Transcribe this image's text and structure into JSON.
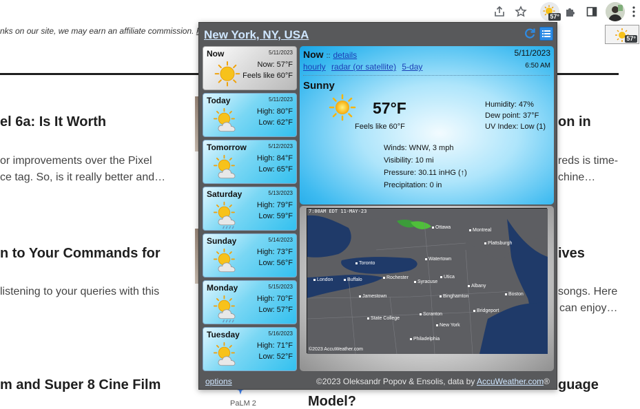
{
  "page": {
    "affiliate_text": "nks on our site, we may earn an affiliate commission.",
    "affiliate_link": "R",
    "articles": [
      {
        "title": "el 6a: Is It Worth",
        "line1": "or improvements over the Pixel",
        "line2": "ce tag. So, is it really better and…"
      },
      {
        "title": "n to Your Commands for",
        "line1": "listening to your queries with this",
        "line2": ""
      },
      {
        "title": "m and Super 8 Cine Film",
        "line1": "",
        "line2": ""
      }
    ],
    "right_fragments": {
      "title1": "on in",
      "body1a": "reds is time-",
      "body1b": "chine…",
      "title2": "ives",
      "body2a": "songs. Here",
      "body2b": "can enjoy…",
      "title3a": "guage",
      "title3b": "Model?"
    },
    "palm_label": "PaLM 2"
  },
  "toolbar": {
    "share_icon": "share-icon",
    "star_icon": "star-icon",
    "ext_badge": "57°",
    "puzzle_icon": "extensions-icon",
    "sidepanel_icon": "side-panel-icon",
    "menu_icon": "kebab-menu-icon",
    "float_badge": "57°"
  },
  "weather": {
    "location": "New York, NY, USA",
    "days": [
      {
        "name": "Now",
        "date": "5/11/2023",
        "line1": "Now: 57°F",
        "line2": "Feels like 60°F",
        "icon": "sun-icon",
        "selected": true
      },
      {
        "name": "Today",
        "date": "5/11/2023",
        "line1": "High: 80°F",
        "line2": "Low: 62°F",
        "icon": "partly-cloudy-icon"
      },
      {
        "name": "Tomorrow",
        "date": "5/12/2023",
        "line1": "High: 84°F",
        "line2": "Low: 65°F",
        "icon": "partly-cloudy-icon"
      },
      {
        "name": "Saturday",
        "date": "5/13/2023",
        "line1": "High: 79°F",
        "line2": "Low: 59°F",
        "icon": "sun-rain-icon"
      },
      {
        "name": "Sunday",
        "date": "5/14/2023",
        "line1": "High: 73°F",
        "line2": "Low: 56°F",
        "icon": "partly-cloudy-icon"
      },
      {
        "name": "Monday",
        "date": "5/15/2023",
        "line1": "High: 70°F",
        "line2": "Low: 57°F",
        "icon": "sun-rain-icon"
      },
      {
        "name": "Tuesday",
        "date": "5/16/2023",
        "line1": "High: 71°F",
        "line2": "Low: 52°F",
        "icon": "partly-cloudy-icon"
      }
    ],
    "now": {
      "heading": "Now",
      "sep": "::",
      "details": "details",
      "links": [
        "hourly",
        "radar (or satellite)",
        "5-day"
      ],
      "date": "5/11/2023",
      "time": "6:50 AM",
      "condition": "Sunny",
      "temp": "57°F",
      "feels": "Feels like 60°F",
      "humidity": "Humidity: 47%",
      "dewpoint": "Dew point: 37°F",
      "uv": "UV Index: Low (1)",
      "winds": "Winds: WNW, 3 mph",
      "visibility": "Visibility: 10 mi",
      "pressure": "Pressure: 30.11 inHG (↑)",
      "precip": "Precipitation: 0 in"
    },
    "radar": {
      "header": "7:00AM EDT 11-MAY-23",
      "footer": "©2023 AccuWeather.com",
      "cities": [
        "Ottawa",
        "Montreal",
        "Plattsburgh",
        "Toronto",
        "Watertown",
        "London",
        "Buffalo",
        "Rochester",
        "Syracuse",
        "Utica",
        "Albany",
        "Jamestown",
        "Binghamton",
        "Boston",
        "State College",
        "Scranton",
        "Bridgeport",
        "New York",
        "Philadelphia"
      ]
    },
    "footer": {
      "options": "options",
      "credit_text": "©2023 Oleksandr Popov & Ensolis, data by ",
      "credit_link": "AccuWeather.com",
      "credit_mark": "®"
    },
    "colors": {
      "accent": "#2d8ce6",
      "link": "#cfe6ff",
      "panel": "#58595b"
    }
  }
}
